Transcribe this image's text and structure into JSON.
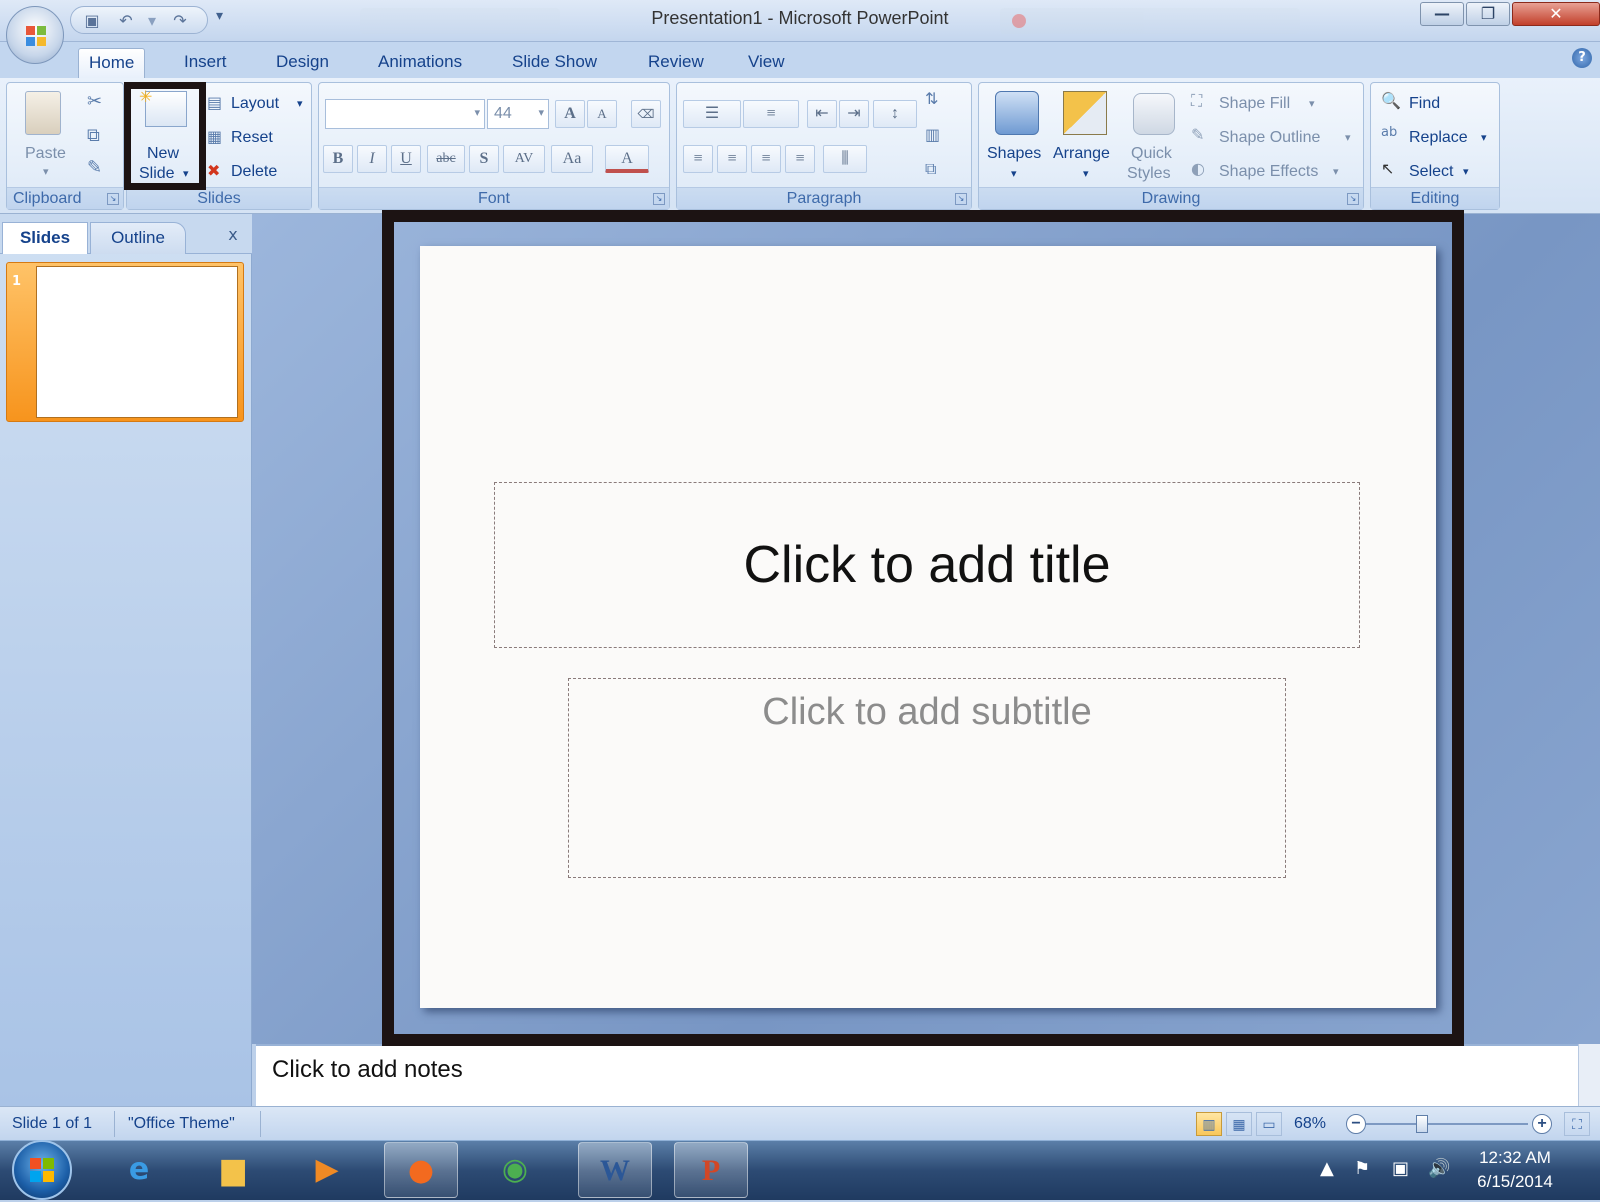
{
  "window": {
    "title": "Presentation1 - Microsoft PowerPoint",
    "minimize_glyph": "—",
    "restore_glyph": "❐",
    "close_glyph": "✕"
  },
  "quick_access": {
    "icons": [
      "save-icon",
      "undo-icon",
      "redo-icon"
    ],
    "more_glyph": "▾"
  },
  "tabs": [
    {
      "label": "Home",
      "active": true
    },
    {
      "label": "Insert"
    },
    {
      "label": "Design"
    },
    {
      "label": "Animations"
    },
    {
      "label": "Slide Show"
    },
    {
      "label": "Review"
    },
    {
      "label": "View"
    }
  ],
  "ribbon": {
    "clipboard": {
      "label": "Clipboard",
      "paste": "Paste"
    },
    "slides": {
      "label": "Slides",
      "new_slide_line1": "New",
      "new_slide_line2": "Slide",
      "layout": "Layout",
      "reset": "Reset",
      "delete": "Delete"
    },
    "font": {
      "label": "Font",
      "font_name": "",
      "font_size": "44",
      "bold": "B",
      "italic": "I",
      "underline": "U",
      "strike": "abc",
      "shadow": "S",
      "spacing": "AV",
      "change_case": "Aa",
      "color": "A",
      "grow": "A",
      "shrink": "A"
    },
    "paragraph": {
      "label": "Paragraph"
    },
    "drawing": {
      "label": "Drawing",
      "shapes": "Shapes",
      "arrange": "Arrange",
      "quick_styles_line1": "Quick",
      "quick_styles_line2": "Styles",
      "shape_fill": "Shape Fill",
      "shape_outline": "Shape Outline",
      "shape_effects": "Shape Effects"
    },
    "editing": {
      "label": "Editing",
      "find": "Find",
      "replace": "Replace",
      "select": "Select"
    }
  },
  "slides_pane": {
    "tab_slides": "Slides",
    "tab_outline": "Outline",
    "close": "x",
    "thumbnail_number": "1"
  },
  "slide": {
    "title_placeholder": "Click to add title",
    "subtitle_placeholder": "Click to add subtitle"
  },
  "notes": {
    "placeholder": "Click to add notes"
  },
  "status": {
    "slide_info": "Slide 1 of 1",
    "theme": "\"Office Theme\"",
    "zoom": "68%",
    "zoom_minus": "−",
    "zoom_plus": "+"
  },
  "taskbar": {
    "time": "12:32 AM",
    "date": "6/15/2014",
    "apps": [
      "internet-explorer-icon",
      "file-explorer-icon",
      "media-player-icon",
      "firefox-icon",
      "chrome-icon",
      "word-icon",
      "powerpoint-icon"
    ]
  },
  "colors": {
    "accent": "#15428b",
    "highlight_border": "#1c1313",
    "thumbnail_selected": "#f7941d"
  }
}
